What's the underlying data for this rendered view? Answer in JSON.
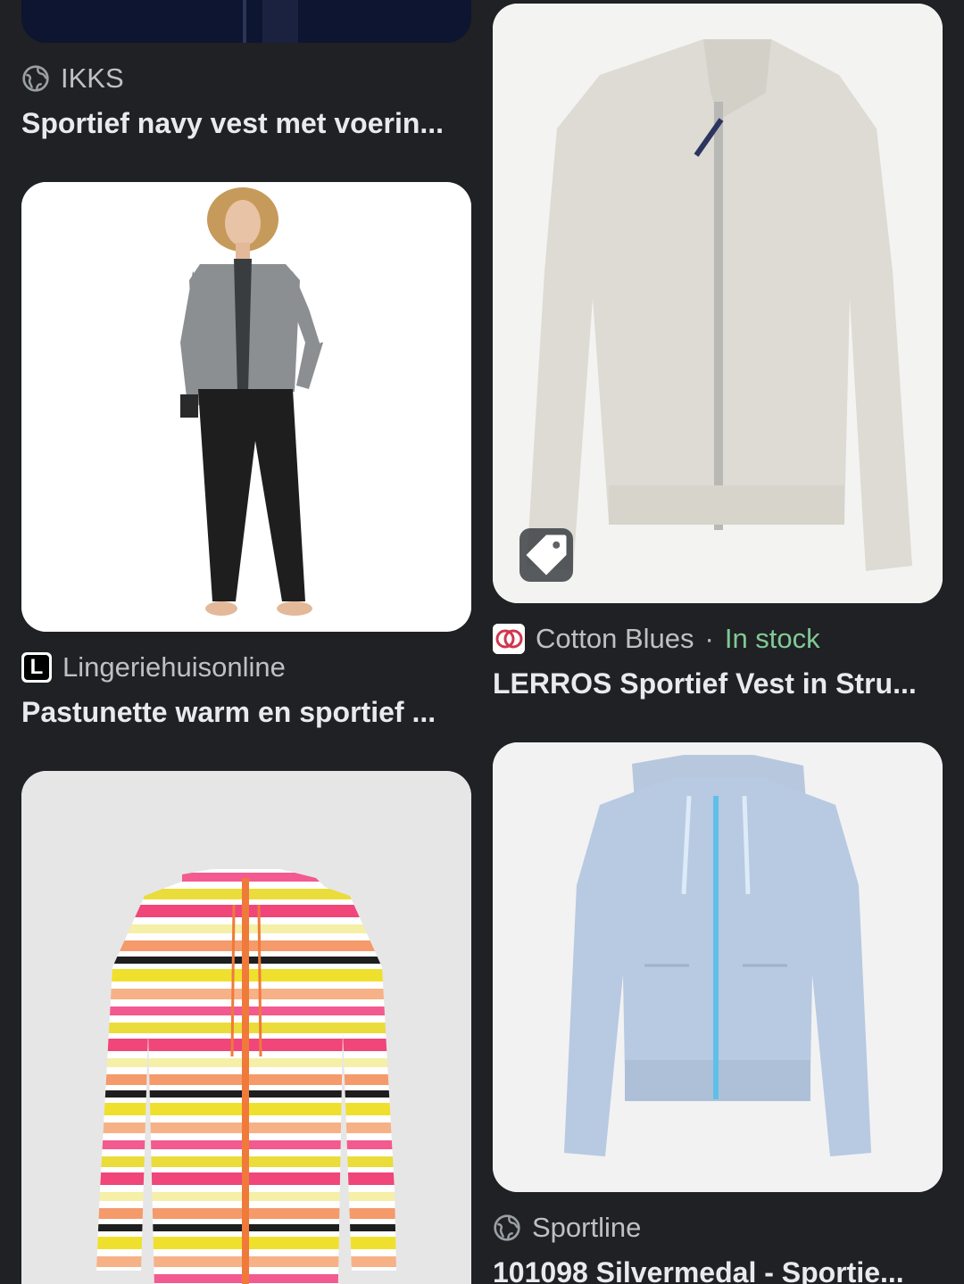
{
  "results": [
    {
      "source": "IKKS",
      "title": "Sportief navy vest met voerin...",
      "icon": "globe-icon"
    },
    {
      "source": "Lingeriehuisonline",
      "favicon_letter": "L",
      "title": "Pastunette warm en sportief ...",
      "image_alt": "woman-in-grey-zip-jacket-and-black-pants"
    },
    {
      "source": "Cotton Blues",
      "separator": "·",
      "stock": "In stock",
      "title": "LERROS Sportief Vest in Stru...",
      "image_alt": "beige-zip-cardigan",
      "tag_icon": "price-tag-icon"
    },
    {
      "image_alt": "striped-zip-hoodie"
    },
    {
      "source": "Sportline",
      "title": "101098 Silvermedal - Sportie...",
      "icon": "globe-icon",
      "image_alt": "light-blue-zip-hoodie"
    }
  ],
  "colors": {
    "background": "#202124",
    "title": "#e8eaed",
    "source": "#bdc1c6",
    "stock": "#81c995"
  }
}
